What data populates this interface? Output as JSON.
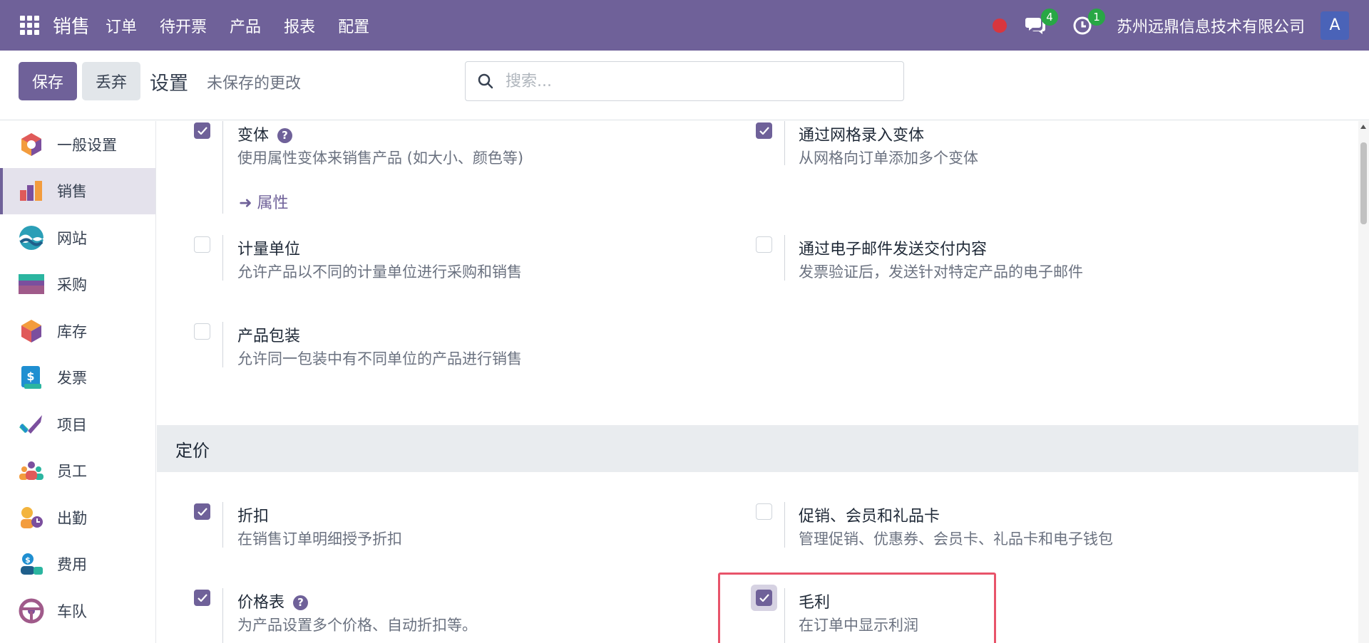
{
  "topbar": {
    "brand": "销售",
    "nav": [
      "订单",
      "待开票",
      "产品",
      "报表",
      "配置"
    ],
    "messages_badge": "4",
    "activities_badge": "1",
    "company": "苏州远鼎信息技术有限公司",
    "avatar": "A",
    "accent": "#6f6199"
  },
  "control": {
    "save_label": "保存",
    "discard_label": "丢弃",
    "breadcrumb": "设置",
    "status": "未保存的更改",
    "search_placeholder": "搜索..."
  },
  "sidebar": {
    "items": [
      {
        "label": "一般设置",
        "icon": "general-settings-icon"
      },
      {
        "label": "销售",
        "icon": "sales-icon",
        "active": true
      },
      {
        "label": "网站",
        "icon": "website-icon"
      },
      {
        "label": "采购",
        "icon": "purchase-icon"
      },
      {
        "label": "库存",
        "icon": "inventory-icon"
      },
      {
        "label": "发票",
        "icon": "invoice-icon"
      },
      {
        "label": "项目",
        "icon": "project-icon"
      },
      {
        "label": "员工",
        "icon": "employees-icon"
      },
      {
        "label": "出勤",
        "icon": "attendance-icon"
      },
      {
        "label": "费用",
        "icon": "expenses-icon"
      },
      {
        "label": "车队",
        "icon": "fleet-icon"
      }
    ]
  },
  "settings": {
    "variants": {
      "title": "变体",
      "desc": "使用属性变体来销售产品 (如大小、颜色等)",
      "checked": true,
      "link": "属性"
    },
    "grid_variants": {
      "title": "通过网格录入变体",
      "desc": "从网格向订单添加多个变体",
      "checked": true
    },
    "uom": {
      "title": "计量单位",
      "desc": "允许产品以不同的计量单位进行采购和销售",
      "checked": false
    },
    "email_delivery": {
      "title": "通过电子邮件发送交付内容",
      "desc": "发票验证后，发送针对特定产品的电子邮件",
      "checked": false
    },
    "packaging": {
      "title": "产品包装",
      "desc": "允许同一包装中有不同单位的产品进行销售",
      "checked": false
    },
    "pricing_section": "定价",
    "discounts": {
      "title": "折扣",
      "desc": "在销售订单明细授予折扣",
      "checked": true
    },
    "promotions": {
      "title": "促销、会员和礼品卡",
      "desc": "管理促销、优惠券、会员卡、礼品卡和电子钱包",
      "checked": false
    },
    "pricelists": {
      "title": "价格表",
      "desc": "为产品设置多个价格、自动折扣等。",
      "checked": true
    },
    "margins": {
      "title": "毛利",
      "desc": "在订单中显示利润",
      "checked": true
    }
  }
}
